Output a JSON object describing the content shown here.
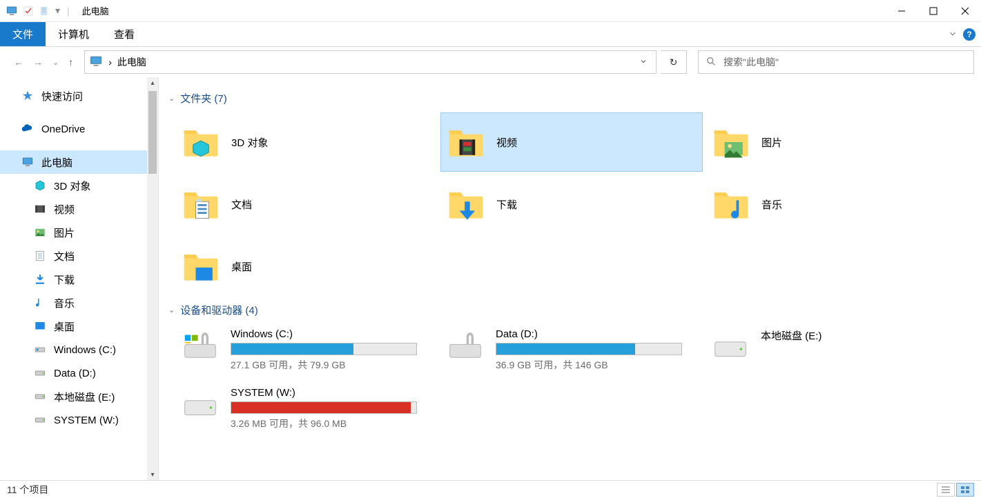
{
  "title": "此电脑",
  "ribbon": {
    "file": "文件",
    "computer": "计算机",
    "view": "查看"
  },
  "address": {
    "path": "此电脑",
    "separator": "›"
  },
  "search": {
    "placeholder": "搜索\"此电脑\""
  },
  "sidebar": {
    "quick_access": "快速访问",
    "onedrive": "OneDrive",
    "this_pc": "此电脑",
    "children": [
      {
        "label": "3D 对象"
      },
      {
        "label": "视频"
      },
      {
        "label": "图片"
      },
      {
        "label": "文档"
      },
      {
        "label": "下载"
      },
      {
        "label": "音乐"
      },
      {
        "label": "桌面"
      },
      {
        "label": "Windows (C:)"
      },
      {
        "label": "Data (D:)"
      },
      {
        "label": "本地磁盘 (E:)"
      },
      {
        "label": "SYSTEM (W:)"
      }
    ]
  },
  "groups": {
    "folders_header": "文件夹 (7)",
    "drives_header": "设备和驱动器 (4)"
  },
  "folders": [
    {
      "name": "3D 对象"
    },
    {
      "name": "视频",
      "selected": true
    },
    {
      "name": "图片"
    },
    {
      "name": "文档"
    },
    {
      "name": "下载"
    },
    {
      "name": "音乐"
    },
    {
      "name": "桌面"
    }
  ],
  "drives": [
    {
      "name": "Windows (C:)",
      "free_text": "27.1 GB 可用，共 79.9 GB",
      "fill_pct": 66,
      "color": "blue",
      "has_bar": true
    },
    {
      "name": "Data (D:)",
      "free_text": "36.9 GB 可用，共 146 GB",
      "fill_pct": 75,
      "color": "blue",
      "has_bar": true
    },
    {
      "name": "本地磁盘 (E:)",
      "free_text": "",
      "fill_pct": 0,
      "color": "",
      "has_bar": false
    },
    {
      "name": "SYSTEM (W:)",
      "free_text": "3.26 MB 可用，共 96.0 MB",
      "fill_pct": 97,
      "color": "red",
      "has_bar": true
    }
  ],
  "status": {
    "count_text": "11 个项目"
  }
}
